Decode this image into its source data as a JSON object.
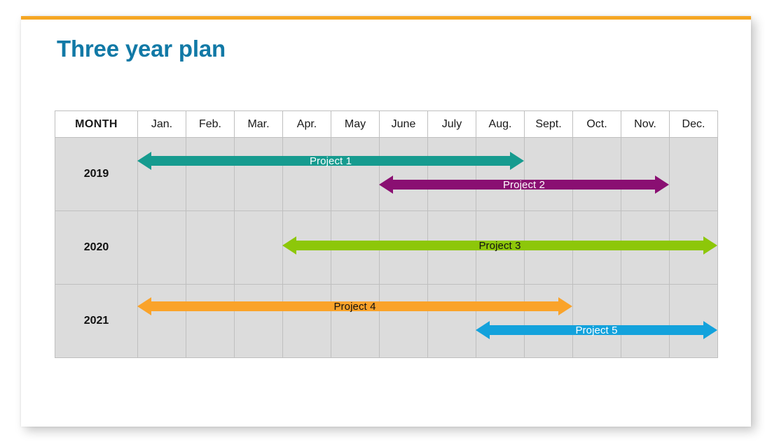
{
  "slide": {
    "title": "Three year plan",
    "accent_top_bar_color": "#F5A623",
    "title_color": "#1179A6",
    "background_color": "#FFFFFF"
  },
  "table": {
    "row_header_label": "MONTH",
    "months": [
      "Jan.",
      "Feb.",
      "Mar.",
      "Apr.",
      "May",
      "June",
      "July",
      "Aug.",
      "Sept.",
      "Oct.",
      "Nov.",
      "Dec."
    ],
    "years": [
      "2019",
      "2020",
      "2021"
    ],
    "cell_fill": "#DCDCDC",
    "header_fill": "#FFFFFF",
    "border_color": "#BFBFBF"
  },
  "chart_data": {
    "type": "bar",
    "title": "Three year plan",
    "xlabel": "MONTH",
    "ylabel": "",
    "categories": [
      "Jan.",
      "Feb.",
      "Mar.",
      "Apr.",
      "May",
      "June",
      "July",
      "Aug.",
      "Sept.",
      "Oct.",
      "Nov.",
      "Dec."
    ],
    "rows": [
      "2019",
      "2020",
      "2021"
    ],
    "bars": [
      {
        "label": "Project 1",
        "row": "2019",
        "start_month": "Jan.",
        "end_month": "Aug.",
        "arrow_heads": "both",
        "color": "#169B8F",
        "text_color": "#FFFFFF"
      },
      {
        "label": "Project 2",
        "row": "2019",
        "start_month": "June",
        "end_month": "Nov.",
        "arrow_heads": "both",
        "color": "#8A0F72",
        "text_color": "#FFFFFF"
      },
      {
        "label": "Project 3",
        "row": "2020",
        "start_month": "Apr.",
        "end_month": "Dec.",
        "arrow_heads": "both",
        "color": "#8DC709",
        "text_color": "#111111"
      },
      {
        "label": "Project 4",
        "row": "2021",
        "start_month": "Jan.",
        "end_month": "Sept.",
        "arrow_heads": "both",
        "color": "#FAA32A",
        "text_color": "#111111"
      },
      {
        "label": "Project 5",
        "row": "2021",
        "start_month": "Aug.",
        "end_month": "Dec.",
        "arrow_heads": "both",
        "color": "#13A2DC",
        "text_color": "#FFFFFF"
      }
    ]
  }
}
